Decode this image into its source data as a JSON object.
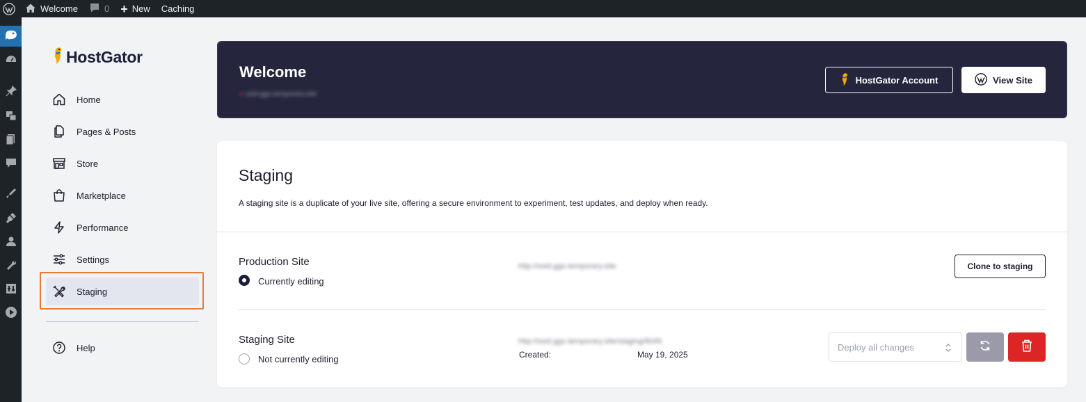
{
  "admin_bar": {
    "site_name": "Welcome",
    "comments_count": "0",
    "new_label": "New",
    "caching_label": "Caching"
  },
  "wp_menu": {
    "items": [
      "plugin-icon",
      "dashboard-icon",
      "pin-icon",
      "media-icon",
      "pages-icon",
      "comments-icon",
      "appearance-icon",
      "plugins-icon",
      "users-icon",
      "tools-icon",
      "settings-icon",
      "play-icon"
    ]
  },
  "sidebar": {
    "brand": "HostGator",
    "items": [
      {
        "label": "Home",
        "icon": "home-icon"
      },
      {
        "label": "Pages & Posts",
        "icon": "pages-icon"
      },
      {
        "label": "Store",
        "icon": "store-icon"
      },
      {
        "label": "Marketplace",
        "icon": "bag-icon"
      },
      {
        "label": "Performance",
        "icon": "bolt-icon"
      },
      {
        "label": "Settings",
        "icon": "sliders-icon"
      },
      {
        "label": "Staging",
        "icon": "tools-icon",
        "active": true
      }
    ],
    "help_label": "Help"
  },
  "banner": {
    "title": "Welcome",
    "site_url": "ssid.ggo.temporary.site",
    "account_button": "HostGator Account",
    "view_site_button": "View Site"
  },
  "staging": {
    "title": "Staging",
    "description": "A staging site is a duplicate of your live site, offering a secure environment to experiment, test updates, and deploy when ready.",
    "production": {
      "name": "Production Site",
      "status": "Currently editing",
      "url": "http://ssid.ggo.temporary.site",
      "clone_button": "Clone to staging"
    },
    "staging_site": {
      "name": "Staging Site",
      "status": "Not currently editing",
      "url": "http://ssid.ggo.temporary.site/staging/8045",
      "created_label": "Created:",
      "created_date": "May 19, 2025",
      "deploy_select": "Deploy all changes"
    }
  },
  "colors": {
    "banner_bg": "#25253d",
    "highlight_border": "#e87b35",
    "delete_red": "#dc2626",
    "sync_gray": "#9a9aaa"
  }
}
